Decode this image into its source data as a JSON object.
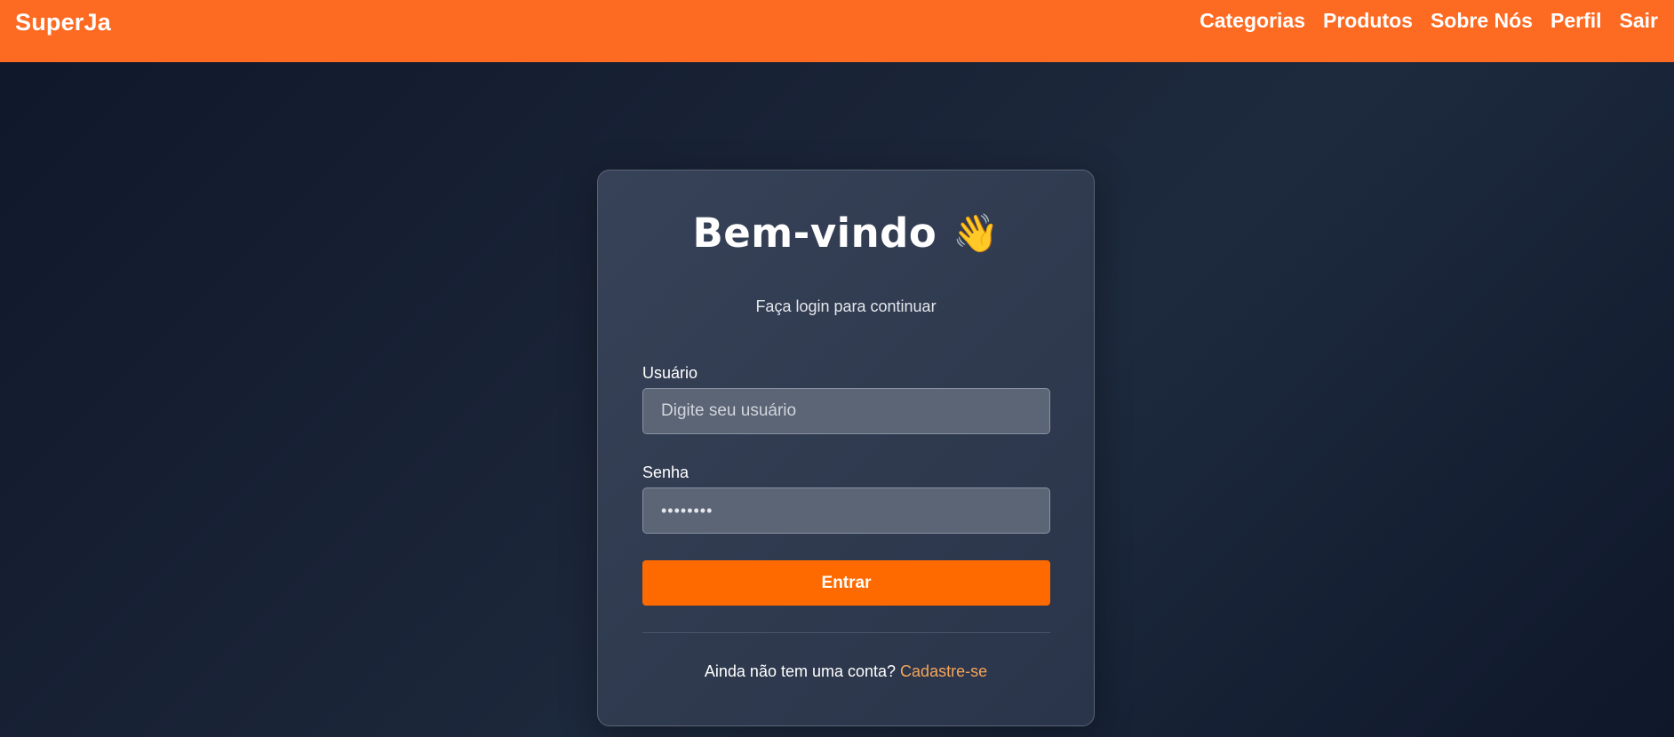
{
  "navbar": {
    "brand": "SuperJa",
    "links": [
      "Categorias",
      "Produtos",
      "Sobre Nós",
      "Perfil",
      "Sair"
    ]
  },
  "login": {
    "title": "Bem-vindo",
    "wave_icon": "👋",
    "subtitle": "Faça login para continuar",
    "username": {
      "label": "Usuário",
      "placeholder": "Digite seu usuário",
      "value": ""
    },
    "password": {
      "label": "Senha",
      "masked_value": "••••••••"
    },
    "submit_label": "Entrar",
    "signup_prompt": "Ainda não tem uma conta?",
    "signup_link": "Cadastre-se"
  },
  "colors": {
    "navbar_bg": "#fd6a22",
    "button_bg": "#ff6a00",
    "link": "#f6a65a",
    "page_bg": "#0f172a",
    "card_bg": "#374258"
  }
}
